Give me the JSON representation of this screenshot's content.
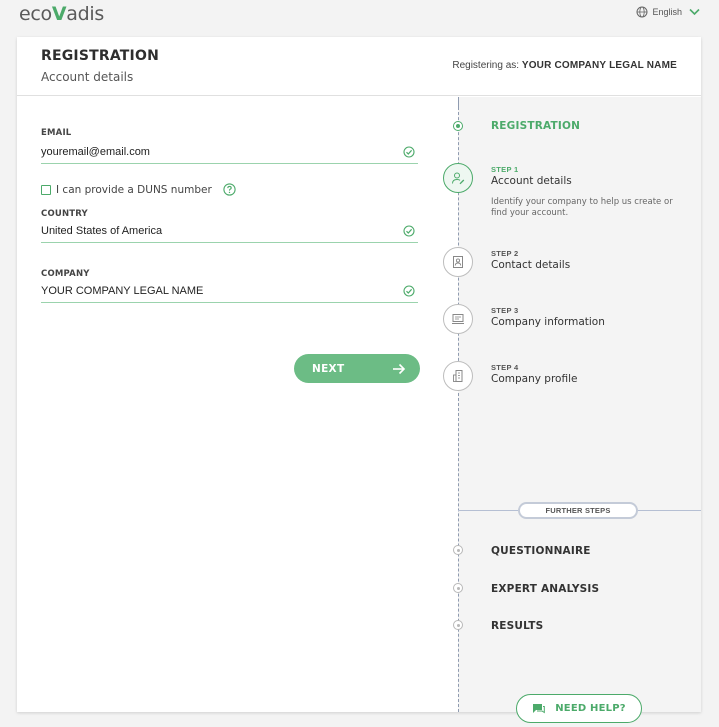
{
  "topbar": {
    "logo_prefix": "eco",
    "logo_v": "V",
    "logo_suffix": "adis",
    "language": "English"
  },
  "header": {
    "title": "REGISTRATION",
    "subtitle": "Account details",
    "registering_label": "Registering as:",
    "registering_value": "YOUR COMPANY LEGAL NAME"
  },
  "form": {
    "email_label": "EMAIL",
    "email_value": "youremail@email.com",
    "duns_label": "I can provide a DUNS number",
    "country_label": "COUNTRY",
    "country_value": "United States of America",
    "company_label": "COMPANY",
    "company_value": "YOUR COMPANY LEGAL NAME",
    "next_label": "NEXT"
  },
  "progress": {
    "title": "REGISTRATION",
    "steps": [
      {
        "num": "STEP 1",
        "name": "Account details",
        "desc": "Identify your company to help us create or find your account."
      },
      {
        "num": "STEP 2",
        "name": "Contact details"
      },
      {
        "num": "STEP 3",
        "name": "Company information"
      },
      {
        "num": "STEP 4",
        "name": "Company profile"
      }
    ],
    "further_label": "FURTHER STEPS",
    "further_items": [
      "QUESTIONNAIRE",
      "EXPERT ANALYSIS",
      "RESULTS"
    ],
    "help_label": "NEED HELP?"
  },
  "colors": {
    "accent": "#4caa6a",
    "button": "#6cbc85",
    "background": "#f3f3f3"
  }
}
